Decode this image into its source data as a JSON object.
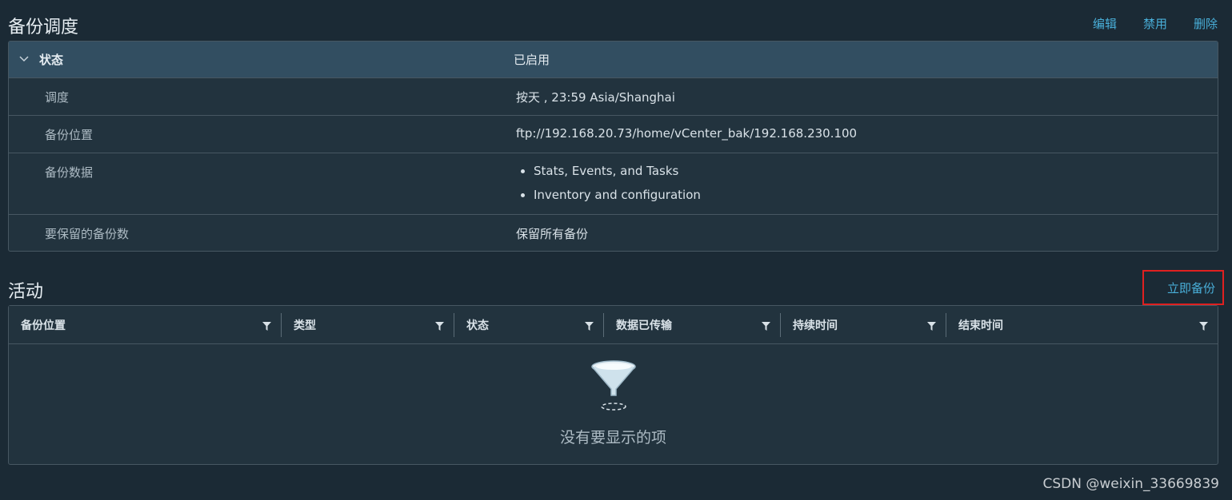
{
  "schedule": {
    "title": "备份调度",
    "actions": {
      "edit": "编辑",
      "disable": "禁用",
      "delete": "删除"
    },
    "status": {
      "label": "状态",
      "value": "已启用"
    },
    "rows": {
      "schedule": {
        "label": "调度",
        "value": "按天 , 23:59 Asia/Shanghai"
      },
      "location": {
        "label": "备份位置",
        "value": "ftp://192.168.20.73/home/vCenter_bak/192.168.230.100"
      },
      "data": {
        "label": "备份数据",
        "items": [
          "Stats, Events, and Tasks",
          "Inventory and configuration"
        ]
      },
      "retain": {
        "label": "要保留的备份数",
        "value": "保留所有备份"
      }
    }
  },
  "activity": {
    "title": "活动",
    "backup_now": "立即备份",
    "columns": [
      "备份位置",
      "类型",
      "状态",
      "数据已传输",
      "持续时间",
      "结束时间"
    ],
    "empty_text": "没有要显示的项"
  },
  "watermark": "CSDN @weixin_33669839",
  "colors": {
    "accent": "#49afd9",
    "highlight": "#e02020",
    "background": "#1b2a35",
    "header_row": "#324e61"
  }
}
